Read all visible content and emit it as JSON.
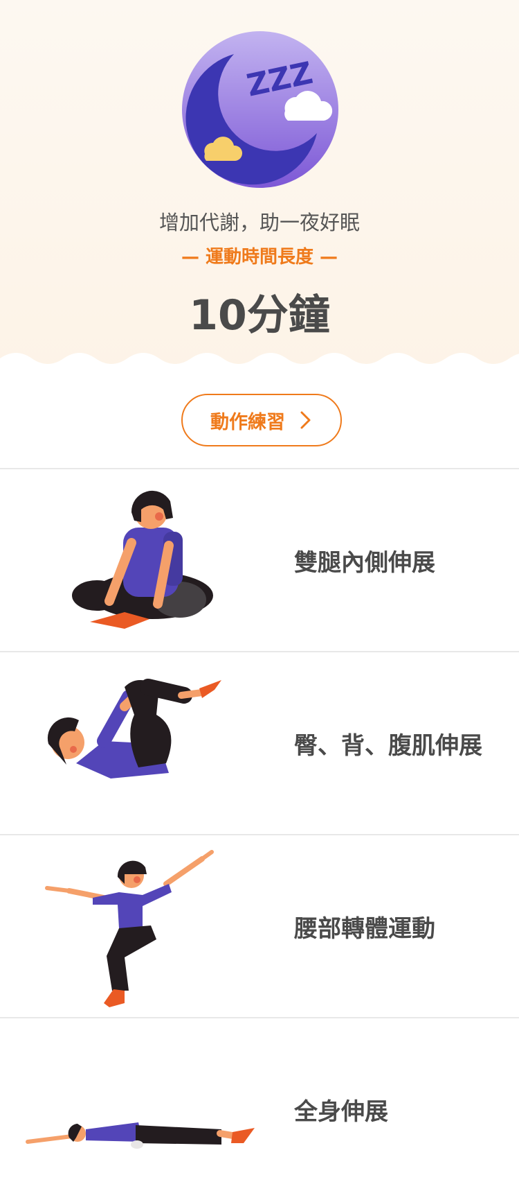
{
  "hero": {
    "icon": "moon-sleep-icon",
    "zzz_text": "ZZZ",
    "subtitle": "增加代謝，助一夜好眠",
    "duration_label": "— 運動時間長度 —",
    "duration_value": "10分鐘"
  },
  "practice_button": {
    "label": "動作練習",
    "icon": "chevron-right-icon"
  },
  "exercises": [
    {
      "name": "雙腿內側伸展",
      "illustration": "seated-butterfly-stretch-figure"
    },
    {
      "name": "臀、背、腹肌伸展",
      "illustration": "knee-hug-stretch-figure"
    },
    {
      "name": "腰部轉體運動",
      "illustration": "squat-twist-figure"
    },
    {
      "name": "全身伸展",
      "illustration": "lying-full-body-stretch-figure"
    }
  ],
  "colors": {
    "accent": "#ef7a1b",
    "moon_bg": "#9b7fe2",
    "moon": "#3c36b2",
    "shirt": "#5345b8",
    "pants": "#231c1f",
    "skin": "#f5a06a",
    "sock": "#ea5a24",
    "divider": "#e8e8e8"
  }
}
